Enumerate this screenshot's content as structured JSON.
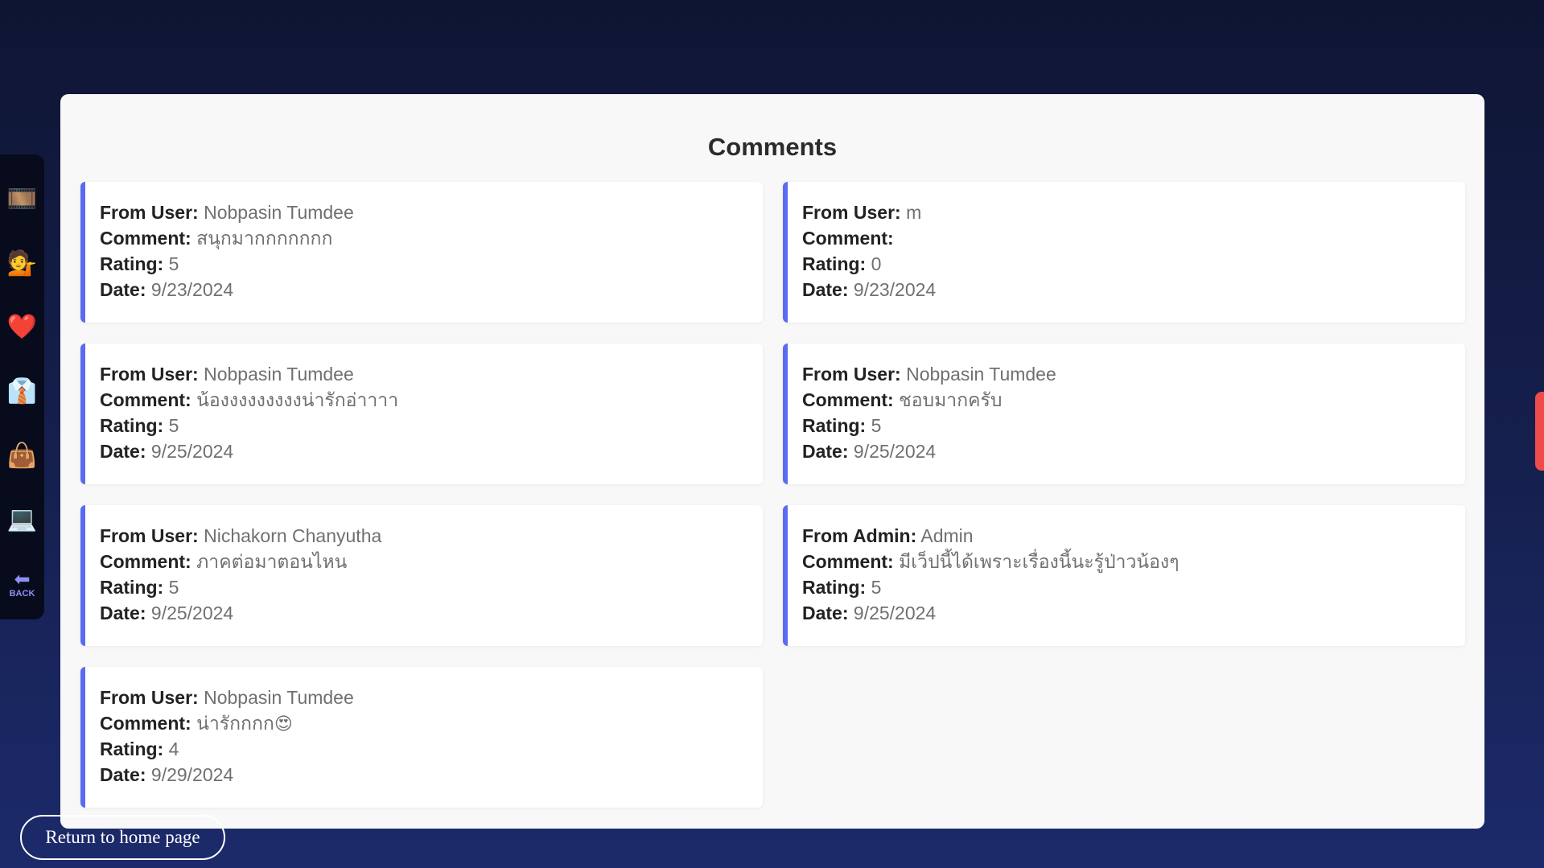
{
  "sidebar": {
    "items": [
      {
        "name": "film-icon",
        "glyph": "🎞️",
        "color": "#5a8ee6"
      },
      {
        "name": "person-tipping-hand-icon",
        "glyph": "💁",
        "color": "#e09ab0"
      },
      {
        "name": "heart-icon",
        "glyph": "❤️",
        "color": "#e8365b"
      },
      {
        "name": "suit-icon",
        "glyph": "👔",
        "color": "#3d5fc4"
      },
      {
        "name": "handbag-icon",
        "glyph": "👜",
        "color": "#c28566"
      },
      {
        "name": "laptop-icon",
        "glyph": "💻",
        "color": "#4aa7de"
      }
    ],
    "back": {
      "glyph": "⬅",
      "label": "BACK",
      "color": "#8f8ff5"
    }
  },
  "panel": {
    "title": "Comments",
    "labels": {
      "from_user": "From User:",
      "from_admin": "From Admin:",
      "comment": "Comment:",
      "rating": "Rating:",
      "date": "Date:"
    },
    "comments": [
      {
        "from_label": "From User:",
        "user": "Nobpasin Tumdee",
        "comment": "สนุกมากกกกกกก",
        "rating": "5",
        "date": "9/23/2024"
      },
      {
        "from_label": "From User:",
        "user": "m",
        "comment": "",
        "rating": "0",
        "date": "9/23/2024"
      },
      {
        "from_label": "From User:",
        "user": "Nobpasin Tumdee",
        "comment": "น้องงงงงงงงงน่ารักอ่าาาา",
        "rating": "5",
        "date": "9/25/2024"
      },
      {
        "from_label": "From User:",
        "user": "Nobpasin Tumdee",
        "comment": "ชอบมากครับ",
        "rating": "5",
        "date": "9/25/2024"
      },
      {
        "from_label": "From User:",
        "user": "Nichakorn Chanyutha",
        "comment": "ภาคต่อมาตอนไหน",
        "rating": "5",
        "date": "9/25/2024"
      },
      {
        "from_label": "From Admin:",
        "user": "Admin",
        "comment": "มีเว็ปนี้ได้เพราะเรื่องนี้นะรู้ป่าวน้องๆ",
        "rating": "5",
        "date": "9/25/2024"
      },
      {
        "from_label": "From User:",
        "user": "Nobpasin Tumdee",
        "comment": "น่ารักกกก",
        "comment_emoji": "😍",
        "rating": "4",
        "date": "9/29/2024"
      }
    ]
  },
  "footer": {
    "home_button": "Return to home page"
  },
  "colors": {
    "card_accent": "#5b6bef",
    "right_tab": "#ef4b4b"
  }
}
